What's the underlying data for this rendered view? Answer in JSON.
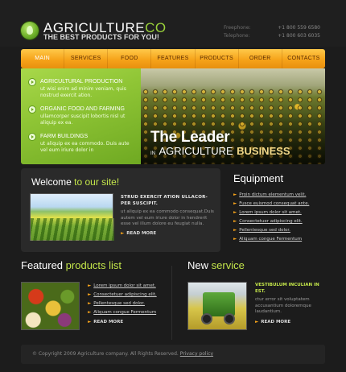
{
  "header": {
    "logo_main": "AGRICULTURE",
    "logo_accent": "CO",
    "slogan": "THE BEST PRODUCTS FOR YOU!",
    "contacts": [
      {
        "label": "Freephone:",
        "value": "+1 800 559 6580"
      },
      {
        "label": "Telephone:",
        "value": "+1 800 603 6035"
      }
    ]
  },
  "nav": {
    "items": [
      "MAIN",
      "SERVICES",
      "FOOD",
      "FEATURES",
      "PRODUCTS",
      "ORDER",
      "CONTACTS"
    ],
    "active": "MAIN"
  },
  "hero": {
    "features": [
      {
        "title": "AGRICULTURAL PRODUCTION",
        "text": "ut wisi enim ad minim veniam, quis nostrud exercit ation."
      },
      {
        "title": "ORGANIC FOOD AND FARMING",
        "text": "ullamcorper suscipit lobortis nisl ut aliquip ex ea."
      },
      {
        "title": "FARM BUILDINGS",
        "text": "ut aliquip ex ea commodo. Duis aute vel eum iriure dolor in"
      }
    ],
    "title1": "The Leader",
    "title2_prefix": "IN",
    "title2_main": "AGRICULTURE",
    "title2_bold": "BUSINESS"
  },
  "welcome": {
    "heading_a": "Welcome",
    "heading_b": "to our site!",
    "subheading": "STRUD EXERCIT ATION ULLACOR-PER SUSCIPIT.",
    "text": "ut aliquip ex ea commodo consequat.Duis autem vel eum iriure dolor in hendrerit esse vel illum dolore eu feugiat nulla.",
    "read_more": "READ MORE"
  },
  "equipment": {
    "title": "Equipment",
    "links": [
      "Proin dictum elementum velit.",
      "Fusce euismod consequat ante.",
      "Lorem ipsum dolor sit amet.",
      "Consectetuer adipiscing elit.",
      "Pellentesque sed dolor.",
      "Aliquam congue Fermentum"
    ]
  },
  "featured": {
    "title_a": "Featured",
    "title_b": "products list",
    "links": [
      "Lorem ipsum dolor sit amet.",
      "Consectetuer adipiscing elit.",
      "Pellentesque sed dolor.",
      "Aliquam congue Fermentum"
    ],
    "read_more": "READ MORE"
  },
  "new_service": {
    "title_a": "New",
    "title_b": "service",
    "subheading": "VESTIBULUM INCULIAN IN EST.",
    "text": "ctur error sit voluptatem accusantium doloremque laudantium.",
    "read_more": "READ MORE"
  },
  "footer": {
    "copyright": "©  Copyright 2009 Agriculture company. All Rights Reserved.",
    "privacy": "Privacy policy"
  },
  "colors": {
    "accent_green": "#9ad13a",
    "nav_orange": "#f6a31a",
    "background": "#1c1c1c"
  }
}
